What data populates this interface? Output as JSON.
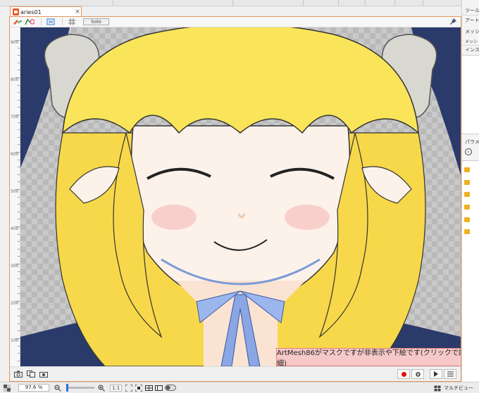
{
  "document_tab": {
    "label": "aries01",
    "close_label": "×"
  },
  "toolbar": {
    "solo_label": "Solo",
    "icons": [
      "brush-icon",
      "mesh-edit-icon",
      "deform-icon",
      "fit-icon",
      "grid-icon"
    ]
  },
  "ruler": {
    "labels": [
      "900",
      "800",
      "700",
      "600",
      "500",
      "400",
      "300",
      "200",
      "100"
    ]
  },
  "warning": {
    "text": "ArtMesh86がマスクですが非表示や下絵です(クリックで詳細)"
  },
  "statusbar": {
    "zoom_value": "97.6 %",
    "one_to_one_label": "1:1",
    "multiview_label": "マルチビュー"
  },
  "right_panel": {
    "tool_header": "ツール",
    "art_label": "アートメ",
    "mesh_label": "メッシュ",
    "mesh2_label": "メッシ",
    "inspector_label": "インス",
    "param_label": "パラメ"
  },
  "colors": {
    "accent_border": "#e8965a",
    "record": "#e01010",
    "warning_bg": "#f6c8c8",
    "folder": "#f0b020"
  }
}
